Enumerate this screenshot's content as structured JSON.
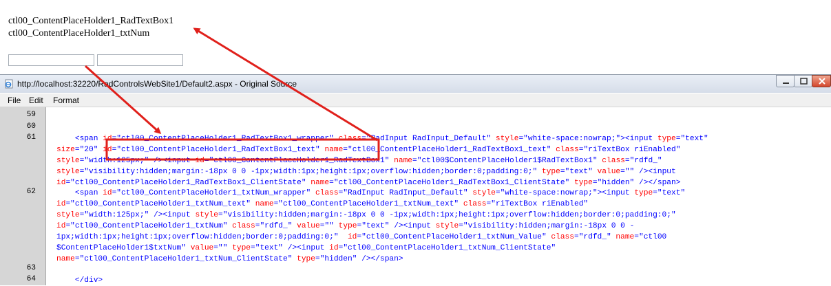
{
  "page": {
    "labels": [
      "ctl00_ContentPlaceHolder1_RadTextBox1",
      "ctl00_ContentPlaceHolder1_txtNum"
    ]
  },
  "viewer": {
    "title": "http://localhost:32220/RadControlsWebSite1/Default2.aspx - Original Source",
    "icon": "ie-page-icon",
    "controls": [
      "minimize-icon",
      "maximize-icon",
      "close-icon"
    ],
    "menu": [
      "File",
      "Edit",
      "Format"
    ],
    "line_numbers": [
      "59",
      "60",
      "61",
      "62",
      "63",
      "64"
    ]
  },
  "code_lines": [
    [
      {
        "t": "tag",
        "s": "    <span "
      },
      {
        "t": "att",
        "s": "id"
      },
      {
        "t": "tag",
        "s": "="
      },
      {
        "t": "val",
        "s": "\"ctl00_ContentPlaceHolder1_RadTextBox1_wrapper\""
      },
      {
        "t": "tag",
        "s": " "
      },
      {
        "t": "att",
        "s": "class"
      },
      {
        "t": "tag",
        "s": "="
      },
      {
        "t": "val",
        "s": "\"RadInput RadInput_Default\""
      },
      {
        "t": "tag",
        "s": " "
      },
      {
        "t": "att",
        "s": "style"
      },
      {
        "t": "tag",
        "s": "="
      },
      {
        "t": "val",
        "s": "\"white-space:nowrap;\""
      },
      {
        "t": "tag",
        "s": "><input "
      },
      {
        "t": "att",
        "s": "type"
      },
      {
        "t": "tag",
        "s": "="
      },
      {
        "t": "val",
        "s": "\"text\""
      }
    ],
    [
      {
        "t": "att",
        "s": "size"
      },
      {
        "t": "tag",
        "s": "="
      },
      {
        "t": "val",
        "s": "\"20\""
      },
      {
        "t": "tag",
        "s": " "
      },
      {
        "t": "att",
        "s": "id"
      },
      {
        "t": "tag",
        "s": "="
      },
      {
        "t": "val",
        "s": "\"ctl00_ContentPlaceHolder1_RadTextBox1_text\""
      },
      {
        "t": "tag",
        "s": " "
      },
      {
        "t": "att",
        "s": "name"
      },
      {
        "t": "tag",
        "s": "="
      },
      {
        "t": "val",
        "s": "\"ctl00_ContentPlaceHolder1_RadTextBox1_text\""
      },
      {
        "t": "tag",
        "s": " "
      },
      {
        "t": "att",
        "s": "class"
      },
      {
        "t": "tag",
        "s": "="
      },
      {
        "t": "val",
        "s": "\"riTextBox riEnabled\""
      }
    ],
    [
      {
        "t": "att",
        "s": "style"
      },
      {
        "t": "tag",
        "s": "="
      },
      {
        "t": "val",
        "s": "\"width:125px;\""
      },
      {
        "t": "tag",
        "s": " /><input "
      },
      {
        "t": "att",
        "s": "id"
      },
      {
        "t": "tag",
        "s": "="
      },
      {
        "t": "val",
        "s": "\"ctl00_ContentPlaceHolder1_RadTextBox1\""
      },
      {
        "t": "tag",
        "s": " "
      },
      {
        "t": "att",
        "s": "name"
      },
      {
        "t": "tag",
        "s": "="
      },
      {
        "t": "val",
        "s": "\"ctl00$ContentPlaceHolder1$RadTextBox1\""
      },
      {
        "t": "tag",
        "s": " "
      },
      {
        "t": "att",
        "s": "class"
      },
      {
        "t": "tag",
        "s": "="
      },
      {
        "t": "val",
        "s": "\"rdfd_\""
      }
    ],
    [
      {
        "t": "att",
        "s": "style"
      },
      {
        "t": "tag",
        "s": "="
      },
      {
        "t": "val",
        "s": "\"visibility:hidden;margin:-18px 0 0 -1px;width:1px;height:1px;overflow:hidden;border:0;padding:0;\""
      },
      {
        "t": "tag",
        "s": " "
      },
      {
        "t": "att",
        "s": "type"
      },
      {
        "t": "tag",
        "s": "="
      },
      {
        "t": "val",
        "s": "\"text\""
      },
      {
        "t": "tag",
        "s": " "
      },
      {
        "t": "att",
        "s": "value"
      },
      {
        "t": "tag",
        "s": "="
      },
      {
        "t": "val",
        "s": "\"\""
      },
      {
        "t": "tag",
        "s": " /><input"
      }
    ],
    [
      {
        "t": "att",
        "s": "id"
      },
      {
        "t": "tag",
        "s": "="
      },
      {
        "t": "val",
        "s": "\"ctl00_ContentPlaceHolder1_RadTextBox1_ClientState\""
      },
      {
        "t": "tag",
        "s": " "
      },
      {
        "t": "att",
        "s": "name"
      },
      {
        "t": "tag",
        "s": "="
      },
      {
        "t": "val",
        "s": "\"ctl00_ContentPlaceHolder1_RadTextBox1_ClientState\""
      },
      {
        "t": "tag",
        "s": " "
      },
      {
        "t": "att",
        "s": "type"
      },
      {
        "t": "tag",
        "s": "="
      },
      {
        "t": "val",
        "s": "\"hidden\""
      },
      {
        "t": "tag",
        "s": " /></span>"
      }
    ],
    [
      {
        "t": "tag",
        "s": "    <span "
      },
      {
        "t": "att",
        "s": "id"
      },
      {
        "t": "tag",
        "s": "="
      },
      {
        "t": "val",
        "s": "\"ctl00_ContentPlaceHolder1_txtNum_wrapper\""
      },
      {
        "t": "tag",
        "s": " "
      },
      {
        "t": "att",
        "s": "class"
      },
      {
        "t": "tag",
        "s": "="
      },
      {
        "t": "val",
        "s": "\"RadInput RadInput_Default\""
      },
      {
        "t": "tag",
        "s": " "
      },
      {
        "t": "att",
        "s": "style"
      },
      {
        "t": "tag",
        "s": "="
      },
      {
        "t": "val",
        "s": "\"white-space:nowrap;\""
      },
      {
        "t": "tag",
        "s": "><input "
      },
      {
        "t": "att",
        "s": "type"
      },
      {
        "t": "tag",
        "s": "="
      },
      {
        "t": "val",
        "s": "\"text\""
      }
    ],
    [
      {
        "t": "att",
        "s": "id"
      },
      {
        "t": "tag",
        "s": "="
      },
      {
        "t": "val",
        "s": "\"ctl00_ContentPlaceHolder1_txtNum_text\""
      },
      {
        "t": "tag",
        "s": " "
      },
      {
        "t": "att",
        "s": "name"
      },
      {
        "t": "tag",
        "s": "="
      },
      {
        "t": "val",
        "s": "\"ctl00_ContentPlaceHolder1_txtNum_text\""
      },
      {
        "t": "tag",
        "s": " "
      },
      {
        "t": "att",
        "s": "class"
      },
      {
        "t": "tag",
        "s": "="
      },
      {
        "t": "val",
        "s": "\"riTextBox riEnabled\""
      }
    ],
    [
      {
        "t": "att",
        "s": "style"
      },
      {
        "t": "tag",
        "s": "="
      },
      {
        "t": "val",
        "s": "\"width:125px;\""
      },
      {
        "t": "tag",
        "s": " /><input "
      },
      {
        "t": "att",
        "s": "style"
      },
      {
        "t": "tag",
        "s": "="
      },
      {
        "t": "val",
        "s": "\"visibility:hidden;margin:-18px 0 0 -1px;width:1px;height:1px;overflow:hidden;border:0;padding:0;\""
      }
    ],
    [
      {
        "t": "att",
        "s": "id"
      },
      {
        "t": "tag",
        "s": "="
      },
      {
        "t": "val",
        "s": "\"ctl00_ContentPlaceHolder1_txtNum\""
      },
      {
        "t": "tag",
        "s": " "
      },
      {
        "t": "att",
        "s": "class"
      },
      {
        "t": "tag",
        "s": "="
      },
      {
        "t": "val",
        "s": "\"rdfd_\""
      },
      {
        "t": "tag",
        "s": " "
      },
      {
        "t": "att",
        "s": "value"
      },
      {
        "t": "tag",
        "s": "="
      },
      {
        "t": "val",
        "s": "\"\""
      },
      {
        "t": "tag",
        "s": " "
      },
      {
        "t": "att",
        "s": "type"
      },
      {
        "t": "tag",
        "s": "="
      },
      {
        "t": "val",
        "s": "\"text\""
      },
      {
        "t": "tag",
        "s": " /><input "
      },
      {
        "t": "att",
        "s": "style"
      },
      {
        "t": "tag",
        "s": "="
      },
      {
        "t": "val",
        "s": "\"visibility:hidden;margin:-18px 0 0 -"
      }
    ],
    [
      {
        "t": "val",
        "s": "1px;width:1px;height:1px;overflow:hidden;border:0;padding:0;\""
      },
      {
        "t": "tag",
        "s": "  "
      },
      {
        "t": "att",
        "s": "id"
      },
      {
        "t": "tag",
        "s": "="
      },
      {
        "t": "val",
        "s": "\"ctl00_ContentPlaceHolder1_txtNum_Value\""
      },
      {
        "t": "tag",
        "s": " "
      },
      {
        "t": "att",
        "s": "class"
      },
      {
        "t": "tag",
        "s": "="
      },
      {
        "t": "val",
        "s": "\"rdfd_\""
      },
      {
        "t": "tag",
        "s": " "
      },
      {
        "t": "att",
        "s": "name"
      },
      {
        "t": "tag",
        "s": "="
      },
      {
        "t": "val",
        "s": "\"ctl00"
      }
    ],
    [
      {
        "t": "val",
        "s": "$ContentPlaceHolder1$txtNum\""
      },
      {
        "t": "tag",
        "s": " "
      },
      {
        "t": "att",
        "s": "value"
      },
      {
        "t": "tag",
        "s": "="
      },
      {
        "t": "val",
        "s": "\"\""
      },
      {
        "t": "tag",
        "s": " "
      },
      {
        "t": "att",
        "s": "type"
      },
      {
        "t": "tag",
        "s": "="
      },
      {
        "t": "val",
        "s": "\"text\""
      },
      {
        "t": "tag",
        "s": " /><input "
      },
      {
        "t": "att",
        "s": "id"
      },
      {
        "t": "tag",
        "s": "="
      },
      {
        "t": "val",
        "s": "\"ctl00_ContentPlaceHolder1_txtNum_ClientState\""
      }
    ],
    [
      {
        "t": "att",
        "s": "name"
      },
      {
        "t": "tag",
        "s": "="
      },
      {
        "t": "val",
        "s": "\"ctl00_ContentPlaceHolder1_txtNum_ClientState\""
      },
      {
        "t": "tag",
        "s": " "
      },
      {
        "t": "att",
        "s": "type"
      },
      {
        "t": "tag",
        "s": "="
      },
      {
        "t": "val",
        "s": "\"hidden\""
      },
      {
        "t": "tag",
        "s": " /></span>"
      }
    ],
    [],
    [
      {
        "t": "tag",
        "s": "    </div>"
      }
    ]
  ],
  "colors": {
    "tag": "#0000ff",
    "attribute": "#ff0000",
    "value": "#0000ff",
    "annotation": "#e0201b",
    "gutter": "#d6d6d6"
  }
}
